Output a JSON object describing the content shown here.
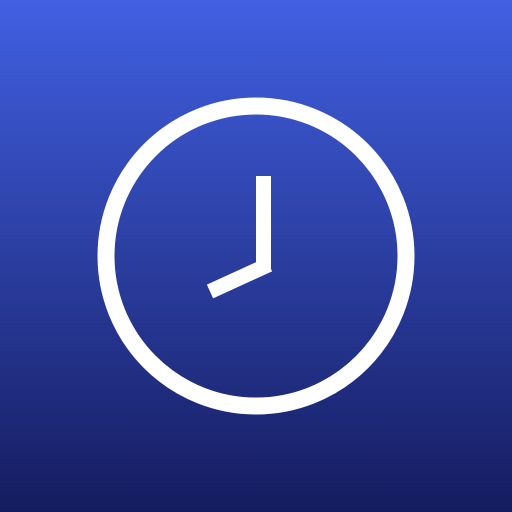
{
  "app_icon": {
    "icon": "clock-icon",
    "background_gradient": {
      "top_color": "#4160E2",
      "bottom_color": "#151C5F"
    },
    "foreground_color": "#FFFFFF",
    "displayed_time": "8:00"
  }
}
